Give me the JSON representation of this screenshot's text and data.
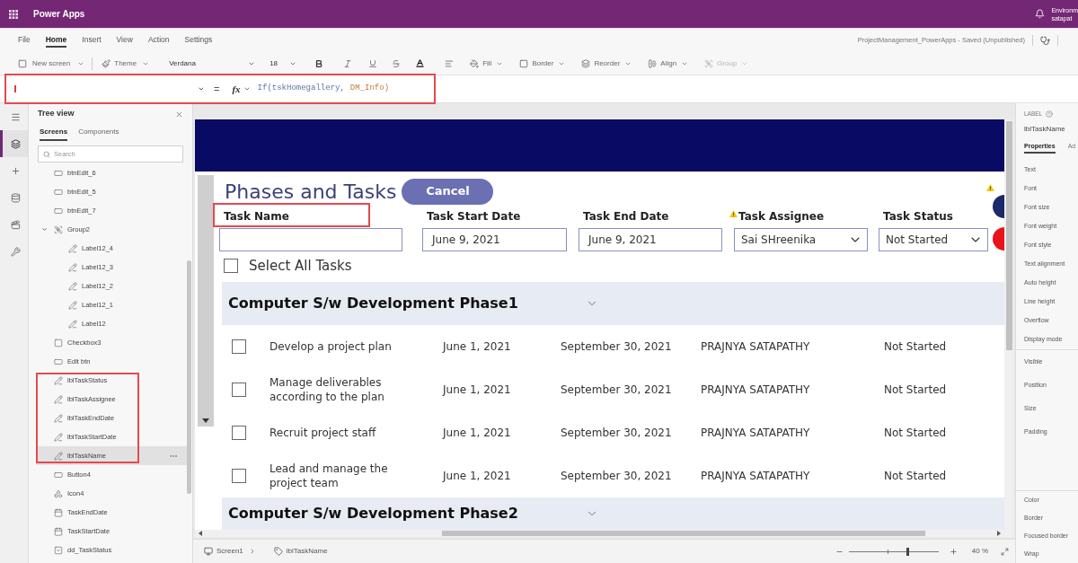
{
  "app_bar": {
    "title": "Power Apps",
    "user_lines": [
      "Environm",
      "satapat"
    ]
  },
  "menu": {
    "tabs": [
      {
        "label": "File",
        "selected": false
      },
      {
        "label": "Home",
        "selected": true
      },
      {
        "label": "Insert",
        "selected": false
      },
      {
        "label": "View",
        "selected": false
      },
      {
        "label": "Action",
        "selected": false
      },
      {
        "label": "Settings",
        "selected": false
      }
    ],
    "document_status": "ProjectManagement_PowerApps - Saved (Unpublished)"
  },
  "toolbar": {
    "new_screen": "New screen",
    "theme": "Theme",
    "font": "Verdana",
    "font_size": "18",
    "actions": [
      {
        "kind": "fill",
        "label": "Fill",
        "disabled": false
      },
      {
        "kind": "border",
        "label": "Border",
        "disabled": false
      },
      {
        "kind": "reorder",
        "label": "Reorder",
        "disabled": false
      },
      {
        "kind": "align",
        "label": "Align",
        "disabled": false
      },
      {
        "kind": "group",
        "label": "Group",
        "disabled": true
      }
    ]
  },
  "formula_bar": {
    "equals": "=",
    "function_label": "fx",
    "formula": [
      {
        "kind": "function",
        "text": "If(tskHomegallery,"
      },
      {
        "kind": "variable",
        "text": "DM_Info)"
      }
    ]
  },
  "left_rail": [
    {
      "kind": "menu",
      "selected": false
    },
    {
      "kind": "tree",
      "selected": true
    },
    {
      "kind": "insert",
      "selected": false
    },
    {
      "kind": "data",
      "selected": false
    },
    {
      "kind": "media",
      "selected": false
    },
    {
      "kind": "tools",
      "selected": false
    }
  ],
  "tree_view": {
    "title": "Tree view",
    "tabs": [
      {
        "label": "Screens",
        "selected": true
      },
      {
        "label": "Components",
        "selected": false
      }
    ],
    "search": {
      "placeholder": "Search"
    },
    "items": [
      {
        "label": "btnEdit_6",
        "kind": "button",
        "selected": false
      },
      {
        "label": "btnEdit_5",
        "kind": "button",
        "selected": false
      },
      {
        "label": "btnEdit_7",
        "kind": "button",
        "selected": false
      },
      {
        "label": "Group2",
        "kind": "group",
        "selected": false,
        "expanded": true,
        "children": [
          {
            "label": "Label12_4",
            "kind": "label",
            "selected": false
          },
          {
            "label": "Label12_3",
            "kind": "label",
            "selected": false
          },
          {
            "label": "Label12_2",
            "kind": "label",
            "selected": false
          },
          {
            "label": "Label12_1",
            "kind": "label",
            "selected": false
          },
          {
            "label": "Label12",
            "kind": "label",
            "selected": false
          }
        ]
      },
      {
        "label": "Checkbox3",
        "kind": "checkbox",
        "selected": false
      },
      {
        "label": "Edit btn",
        "kind": "button",
        "selected": false
      },
      {
        "label": "lblTaskStatus",
        "kind": "label",
        "selected": false
      },
      {
        "label": "lblTaskAssignee",
        "kind": "label",
        "selected": false
      },
      {
        "label": "lblTaskEndDate",
        "kind": "label",
        "selected": false
      },
      {
        "label": "lblTaskStartDate",
        "kind": "label",
        "selected": false
      },
      {
        "label": "lblTaskName",
        "kind": "label",
        "selected": true
      },
      {
        "label": "Button4",
        "kind": "button",
        "selected": false
      },
      {
        "label": "Icon4",
        "kind": "icon",
        "selected": false
      },
      {
        "label": "TaskEndDate",
        "kind": "datepicker",
        "selected": false
      },
      {
        "label": "TaskStartDate",
        "kind": "datepicker",
        "selected": false
      },
      {
        "label": "dd_TaskStatus",
        "kind": "dropdown",
        "selected": false
      }
    ]
  },
  "canvas": {
    "warning": true,
    "title": "Phases and Tasks",
    "cancel_button": "Cancel",
    "filters": [
      {
        "label": "Task Name",
        "kind": "text",
        "warning": false
      },
      {
        "label": "Task Start Date",
        "kind": "date",
        "value": "June 9, 2021",
        "warning": false
      },
      {
        "label": "Task End Date",
        "kind": "date",
        "value": "June 9, 2021",
        "warning": false
      },
      {
        "label": "Task Assignee",
        "kind": "dropdown",
        "value": "Sai SHreenika",
        "warning": true
      },
      {
        "label": "Task Status",
        "kind": "dropdown",
        "value": "Not Started",
        "warning": false
      }
    ],
    "select_all": {
      "label": "Select All Tasks",
      "checked": false
    },
    "phases": [
      {
        "name": "Computer S/w Development Phase1",
        "expanded": true,
        "tasks": [
          {
            "name": "Develop a project plan",
            "start": "June 1, 2021",
            "end": "September 30, 2021",
            "assignee": "PRAJNYA SATAPATHY",
            "status": "Not Started",
            "checked": false
          },
          {
            "name": "Manage deliverables according to the plan",
            "start": "June 1, 2021",
            "end": "September 30, 2021",
            "assignee": "PRAJNYA SATAPATHY",
            "status": "Not Started",
            "checked": false
          },
          {
            "name": "Recruit project staff",
            "start": "June 1, 2021",
            "end": "September 30, 2021",
            "assignee": "PRAJNYA SATAPATHY",
            "status": "Not Started",
            "checked": false
          },
          {
            "name": "Lead and manage the project team",
            "start": "June 1, 2021",
            "end": "September 30, 2021",
            "assignee": "PRAJNYA SATAPATHY",
            "status": "Not Started",
            "checked": false
          }
        ]
      },
      {
        "name": "Computer S/w Development Phase2",
        "expanded": true
      }
    ]
  },
  "status_bar": {
    "screen": "Screen1",
    "control": "lblTaskName",
    "zoom": {
      "level": 0.66,
      "reading": "40 %"
    }
  },
  "properties_panel": {
    "type": "LABEL",
    "control": "lblTaskName",
    "tabs": [
      {
        "label": "Properties",
        "selected": true
      },
      {
        "label": "Ad",
        "selected": false
      }
    ],
    "groups": [
      [
        "Text",
        "Font",
        "Font size",
        "Font weight",
        "Font style",
        "Text alignment",
        "Auto height",
        "Line height",
        "Overflow",
        "Display mode"
      ],
      [
        "Visible",
        "Position",
        "Size",
        "Padding"
      ],
      [
        "Color",
        "Border",
        "Focused border",
        "Wrap"
      ]
    ]
  }
}
